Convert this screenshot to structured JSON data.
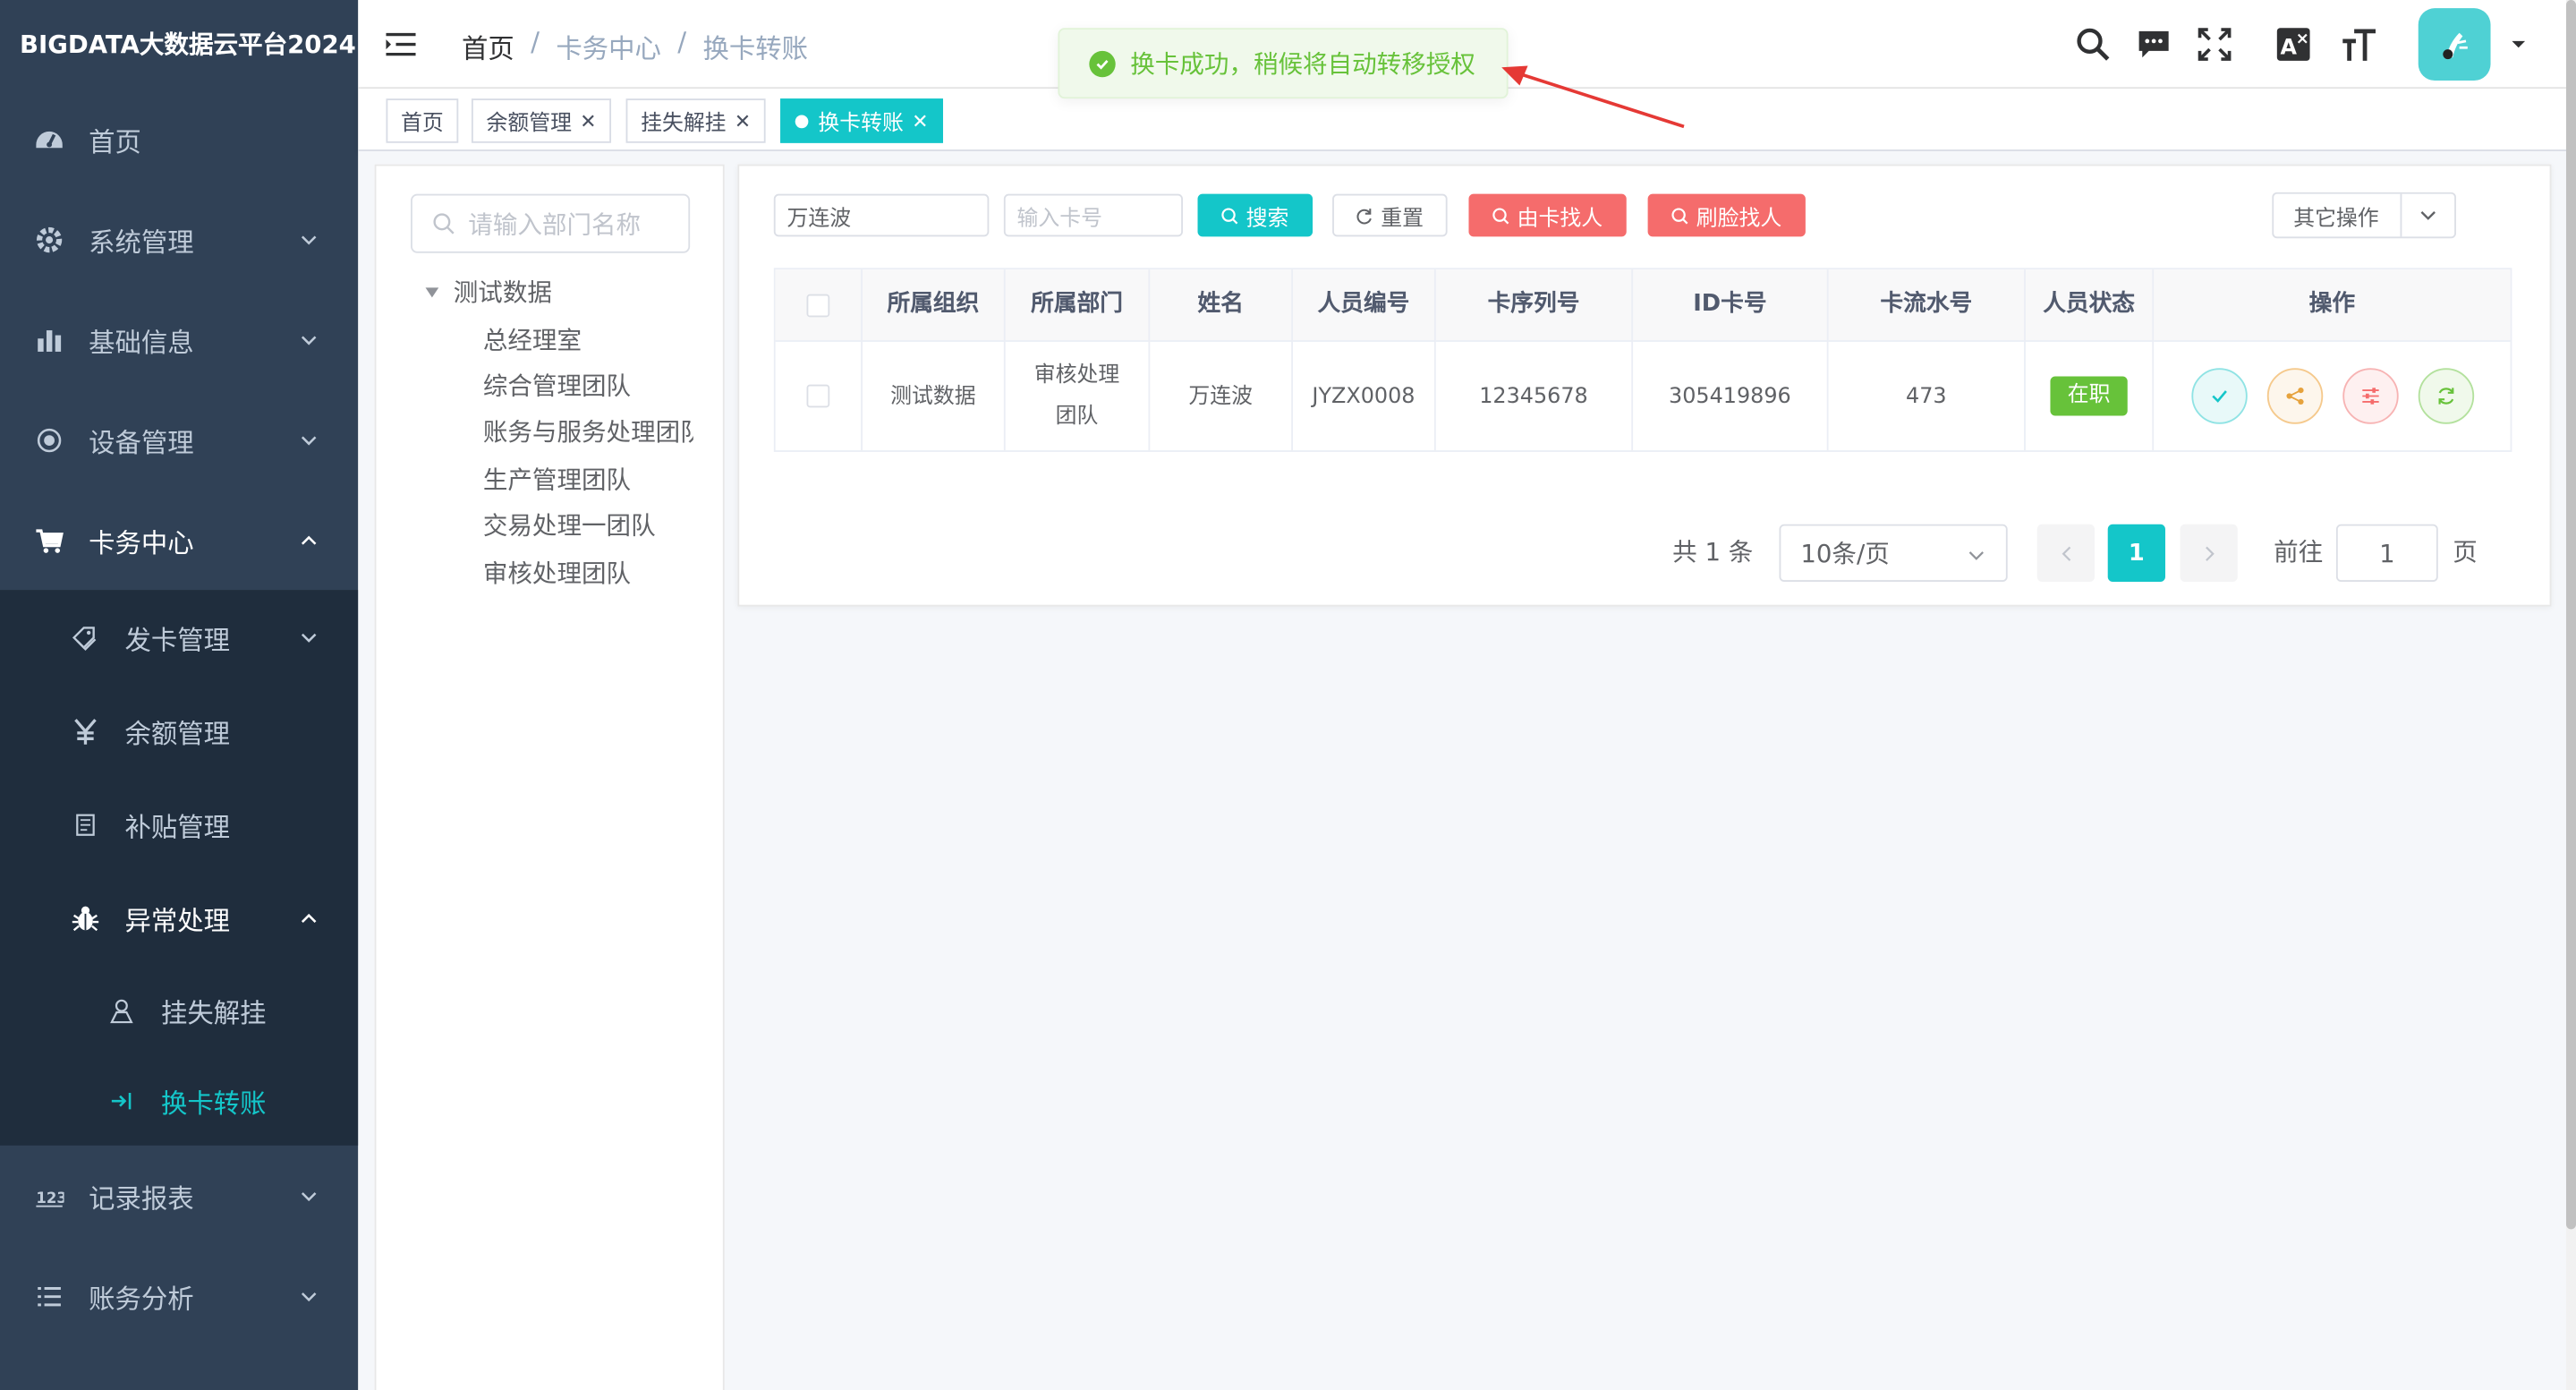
{
  "app": {
    "title": "BIGDATA大数据云平台2024"
  },
  "sidebar": {
    "items": [
      {
        "label": "首页",
        "icon": "dashboard-icon"
      },
      {
        "label": "系统管理",
        "icon": "gear-icon"
      },
      {
        "label": "基础信息",
        "icon": "bar-chart-icon"
      },
      {
        "label": "设备管理",
        "icon": "radio-icon"
      },
      {
        "label": "卡务中心",
        "icon": "cart-icon"
      }
    ],
    "card_center": {
      "children": [
        {
          "label": "发卡管理",
          "icon": "tags-icon"
        },
        {
          "label": "余额管理",
          "icon": "yen-icon"
        },
        {
          "label": "补贴管理",
          "icon": "document-icon"
        },
        {
          "label": "异常处理",
          "icon": "bug-icon"
        }
      ],
      "exception_children": [
        {
          "label": "挂失解挂",
          "icon": "user-icon"
        },
        {
          "label": "换卡转账",
          "icon": "login-arrow-icon"
        }
      ]
    },
    "bottom_items": [
      {
        "label": "记录报表",
        "icon": "number-icon"
      },
      {
        "label": "账务分析",
        "icon": "list-icon"
      }
    ]
  },
  "navbar": {
    "breadcrumb": [
      "首页",
      "卡务中心",
      "换卡转账"
    ],
    "breadcrumb_sep": "/"
  },
  "tags": [
    {
      "label": "首页"
    },
    {
      "label": "余额管理"
    },
    {
      "label": "挂失解挂"
    },
    {
      "label": "换卡转账"
    }
  ],
  "toast": {
    "message": "换卡成功，稍候将自动转移授权",
    "color": "#67c23a"
  },
  "tree": {
    "search_placeholder": "请输入部门名称",
    "root": "测试数据",
    "nodes": [
      "总经理室",
      "综合管理团队",
      "账务与服务处理团队",
      "生产管理团队",
      "交易处理一团队",
      "审核处理团队"
    ]
  },
  "filters": {
    "name_value": "万连波",
    "card_placeholder": "输入卡号",
    "search_btn": "搜索",
    "reset_btn": "重置",
    "find_by_card_btn": "由卡找人",
    "find_by_face_btn": "刷脸找人",
    "other_ops": "其它操作"
  },
  "table": {
    "headers": [
      "所属组织",
      "所属部门",
      "姓名",
      "人员编号",
      "卡序列号",
      "ID卡号",
      "卡流水号",
      "人员状态",
      "操作"
    ],
    "rows": [
      {
        "org": "测试数据",
        "dept": "审核处理团队",
        "name": "万连波",
        "emp_no": "JYZX0008",
        "card_serial": "12345678",
        "id_card": "305419896",
        "card_flow": "473",
        "status": "在职"
      }
    ]
  },
  "pagination": {
    "total_text": "共 1 条",
    "page_size": "10条/页",
    "current_page": "1",
    "goto_label": "前往",
    "goto_value": "1",
    "page_unit": "页"
  },
  "colors": {
    "accent": "#14c6c9",
    "sidebar_bg": "#304156",
    "submenu_bg": "#1f2d3d",
    "danger": "#f56c6c",
    "success": "#67c23a"
  }
}
